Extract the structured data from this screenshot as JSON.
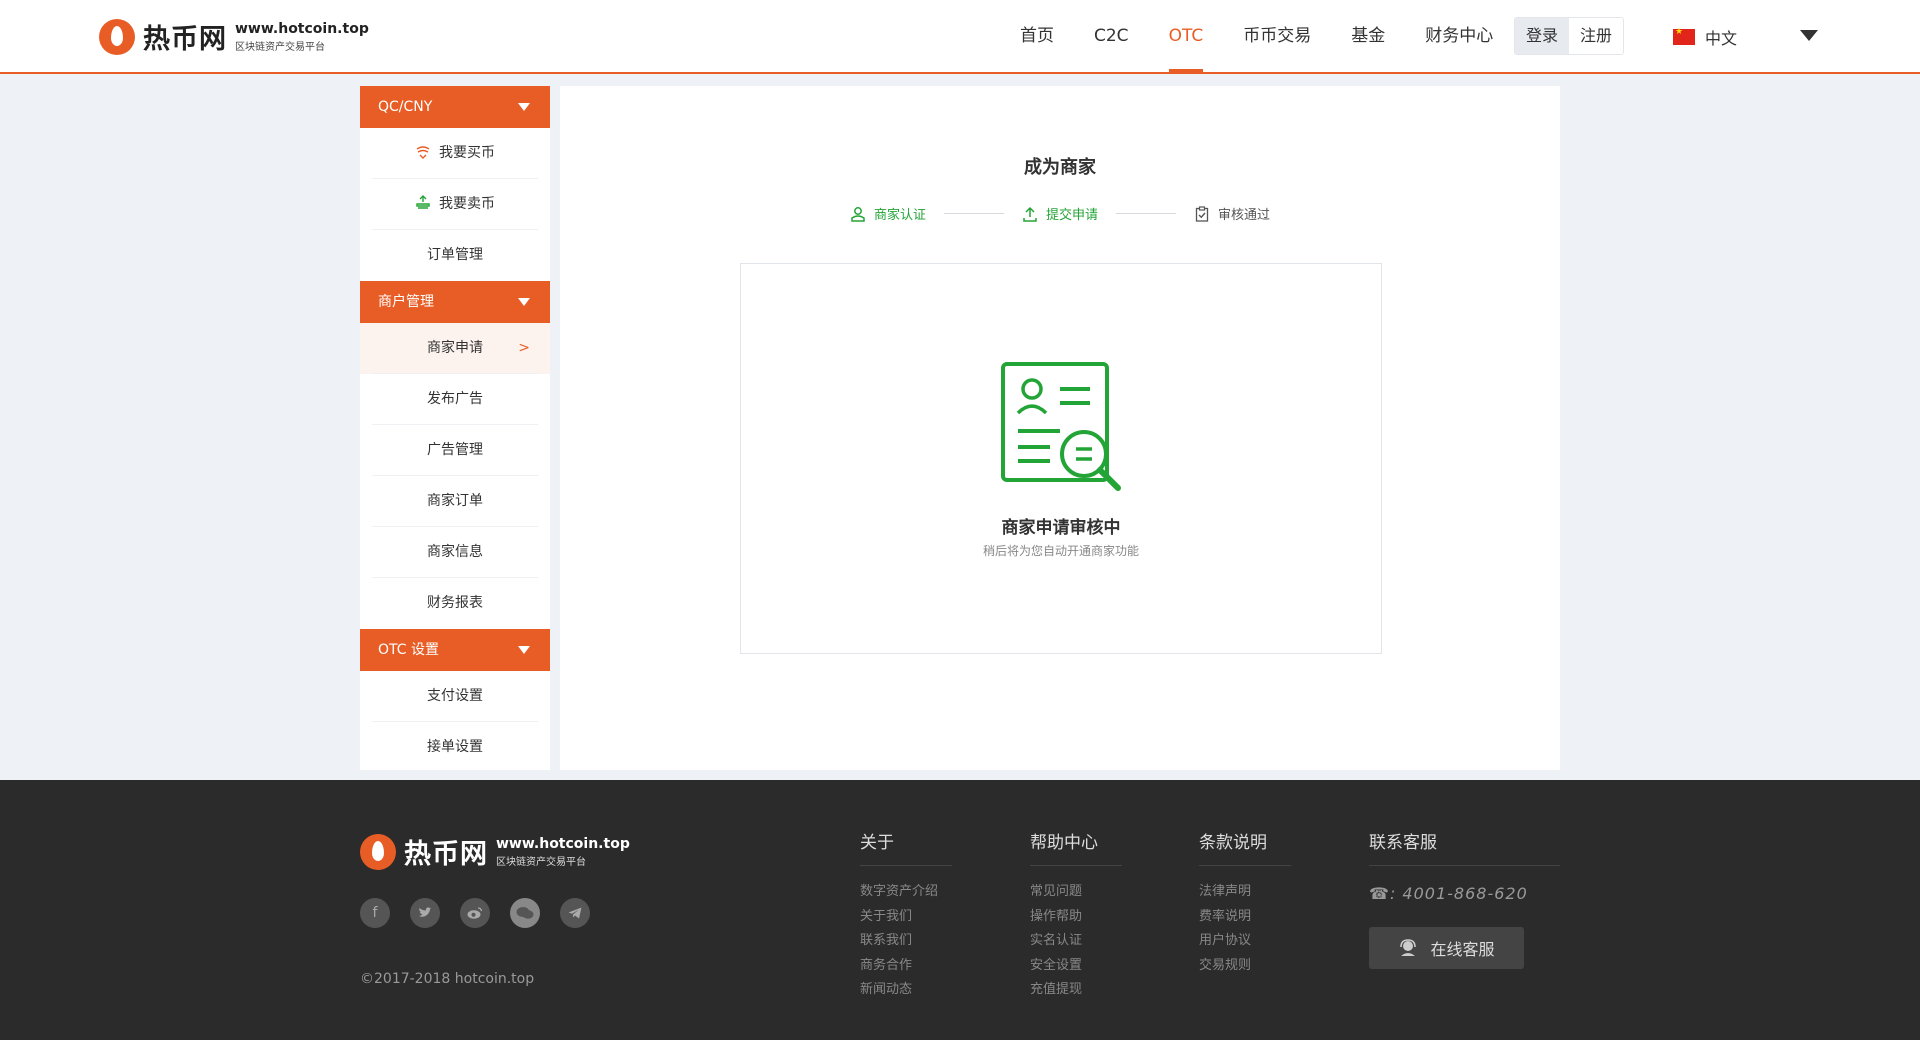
{
  "header": {
    "logo_name": "热币网",
    "logo_url": "www.hotcoin.top",
    "logo_tagline": "区块链资产交易平台",
    "nav": [
      "首页",
      "C2C",
      "OTC",
      "币币交易",
      "基金",
      "财务中心"
    ],
    "active_nav": "OTC",
    "login_label": "登录",
    "register_label": "注册",
    "language": "中文"
  },
  "sidebar": {
    "group1": "QC/CNY",
    "buy": "我要买币",
    "sell": "我要卖币",
    "orders": "订单管理",
    "group2": "商户管理",
    "merchant_apply": "商家申请",
    "active_arrow": ">",
    "publish_ad": "发布广告",
    "ad_manage": "广告管理",
    "merchant_orders": "商家订单",
    "merchant_info": "商家信息",
    "finance_report": "财务报表",
    "group3": "OTC 设置",
    "payment_settings": "支付设置",
    "order_settings": "接单设置"
  },
  "main": {
    "title": "成为商家",
    "steps": [
      {
        "label": "商家认证",
        "status": "done"
      },
      {
        "label": "提交申请",
        "status": "done"
      },
      {
        "label": "审核通过",
        "status": "pending"
      }
    ],
    "status_title": "商家申请审核中",
    "status_sub": "稍后将为您自动开通商家功能"
  },
  "footer": {
    "logo_name": "热币网",
    "logo_url": "www.hotcoin.top",
    "logo_tagline": "区块链资产交易平台",
    "social_icons": [
      "facebook-icon",
      "twitter-icon",
      "weibo-icon",
      "wechat-icon",
      "telegram-icon"
    ],
    "copyright": "©2017-2018 hotcoin.top",
    "about": {
      "title": "关于",
      "links": [
        "数字资产介绍",
        "关于我们",
        "联系我们",
        "商务合作",
        "新闻动态"
      ]
    },
    "help": {
      "title": "帮助中心",
      "links": [
        "常见问题",
        "操作帮助",
        "实名认证",
        "安全设置",
        "充值提现"
      ]
    },
    "terms": {
      "title": "条款说明",
      "links": [
        "法律声明",
        "费率说明",
        "用户协议",
        "交易规则"
      ]
    },
    "contact": {
      "title": "联系客服",
      "phone_icon": "☎",
      "phone": ": 4001-868-620",
      "online_service": "在线客服"
    }
  },
  "colors": {
    "accent": "#e85d26",
    "success": "#23a436",
    "footer_bg": "#2b2b2b"
  }
}
